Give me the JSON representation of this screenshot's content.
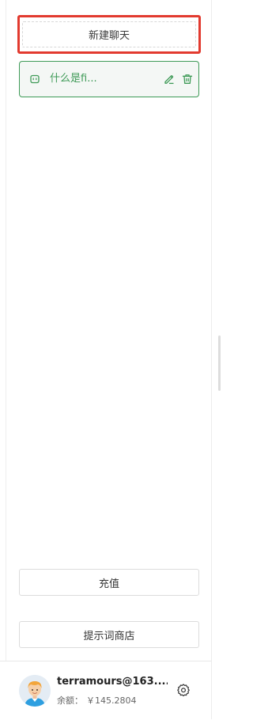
{
  "sidebar": {
    "new_chat_label": "新建聊天",
    "chats": [
      {
        "title": "什么是fi..."
      }
    ],
    "recharge_label": "充值",
    "prompt_store_label": "提示词商店"
  },
  "user": {
    "username": "terramours@163....",
    "balance_label": "余额：",
    "balance_value": "￥145.2804"
  },
  "colors": {
    "accent_green": "#3e9a57",
    "highlight_red": "#e23a2f"
  },
  "icons": {
    "chat": "chat-bubble-icon",
    "edit": "pencil-icon",
    "delete": "trash-icon",
    "settings": "gear-icon",
    "avatar": "avatar-cartoon"
  }
}
